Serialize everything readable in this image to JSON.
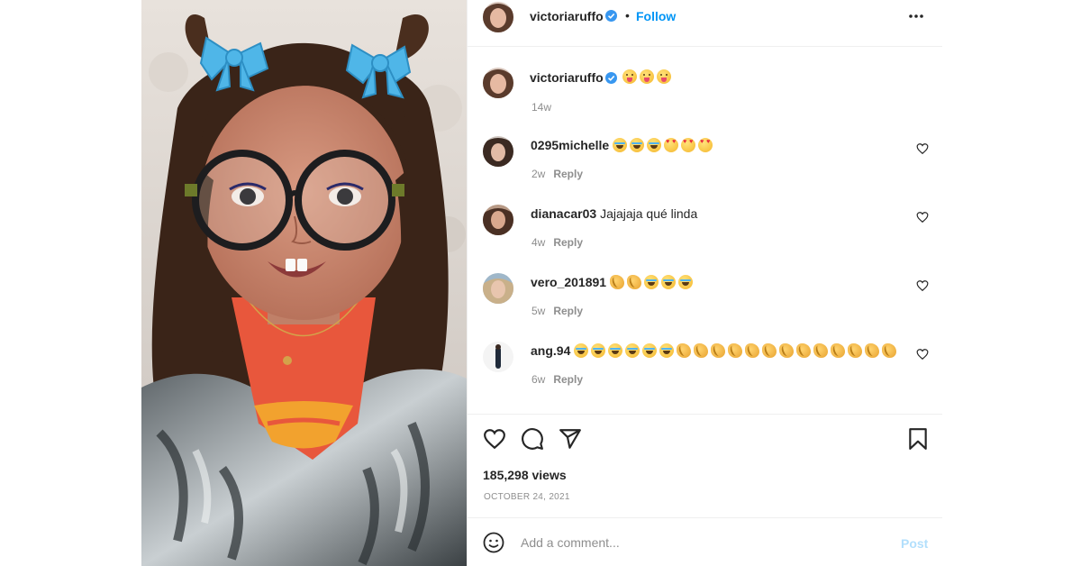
{
  "post": {
    "username": "victoriaruffo",
    "follow_label": "Follow",
    "separator": "•",
    "caption_emojis": [
      "tongue",
      "tongue",
      "tongue"
    ],
    "caption_time": "14w",
    "views": "185,298 views",
    "date": "OCTOBER 24, 2021"
  },
  "comments": [
    {
      "user": "0295michelle",
      "text": "",
      "emojis": [
        "laugh",
        "laugh",
        "laugh",
        "love",
        "love",
        "love"
      ],
      "time": "2w",
      "reply": "Reply"
    },
    {
      "user": "dianacar03",
      "text": "Jajajaja qué linda",
      "emojis": [],
      "time": "4w",
      "reply": "Reply"
    },
    {
      "user": "vero_201891",
      "text": "",
      "emojis": [
        "clap",
        "clap",
        "laugh",
        "laugh",
        "laugh"
      ],
      "time": "5w",
      "reply": "Reply"
    },
    {
      "user": "ang.94",
      "text": "",
      "emojis": [
        "laugh",
        "laugh",
        "laugh",
        "laugh",
        "laugh",
        "laugh",
        "clap",
        "clap",
        "clap",
        "clap",
        "clap",
        "clap",
        "clap",
        "clap",
        "clap",
        "clap",
        "clap",
        "clap",
        "clap"
      ],
      "time": "6w",
      "reply": "Reply"
    }
  ],
  "add_comment": {
    "placeholder": "Add a comment...",
    "post_label": "Post"
  },
  "colors": {
    "link_blue": "#0095f6",
    "post_disabled": "#b2dffc",
    "muted": "#8e8e8e"
  }
}
